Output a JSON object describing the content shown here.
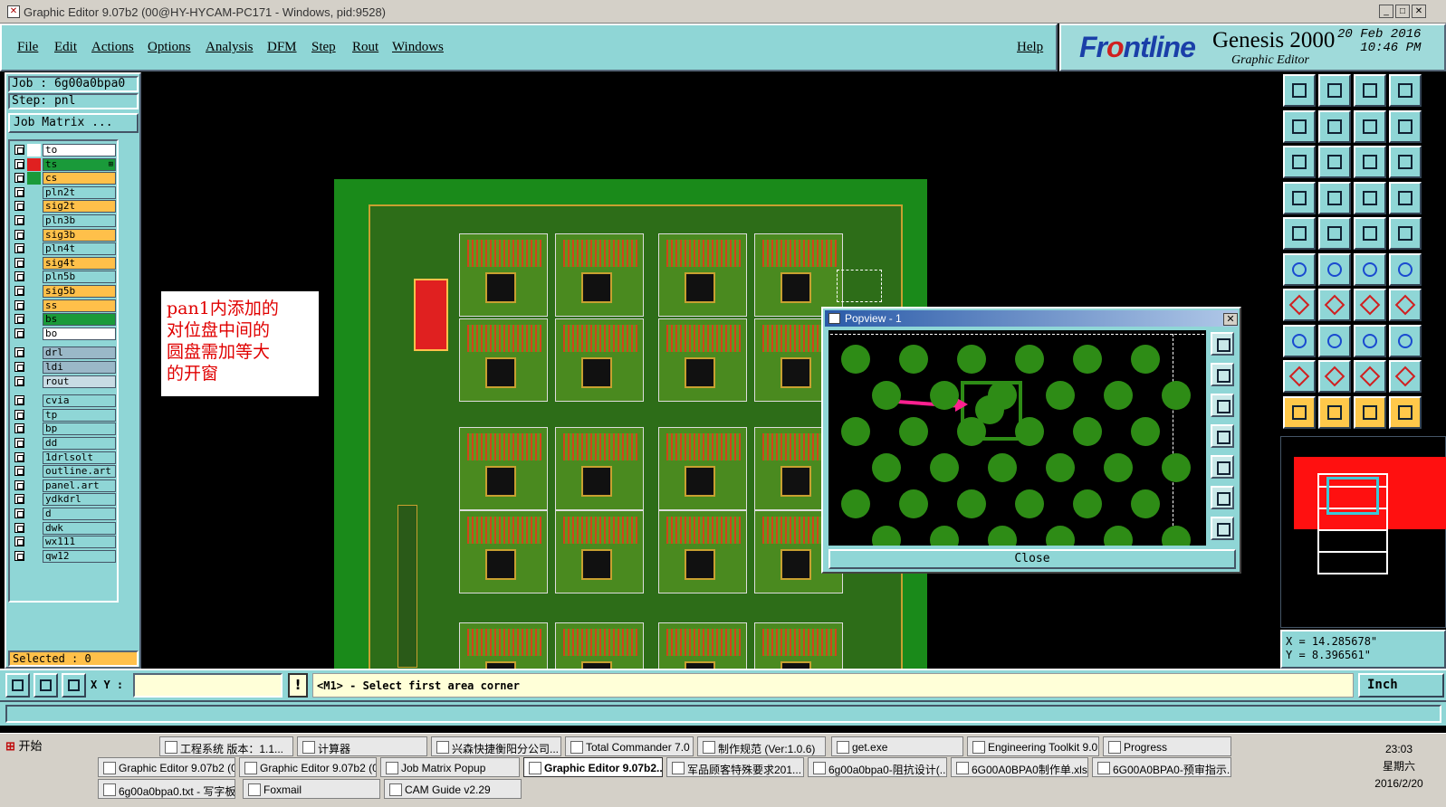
{
  "window": {
    "title": "Graphic Editor 9.07b2 (00@HY-HYCAM-PC171 - Windows, pid:9528)"
  },
  "menu": {
    "items": [
      "File",
      "Edit",
      "Actions",
      "Options",
      "Analysis",
      "DFM",
      "Step",
      "Rout",
      "Windows"
    ],
    "help": "Help"
  },
  "logo": {
    "brand_pre": "Fr",
    "brand_o": "o",
    "brand_post": "ntline",
    "product": "Genesis 2000",
    "subtitle": "Graphic Editor",
    "date": "20 Feb 2016",
    "time": "10:46 PM"
  },
  "job": {
    "job_label": "Job : 6g00a0bpa0",
    "step_label": "Step: pnl",
    "matrix_button": "Job Matrix ..."
  },
  "layers": [
    {
      "name": "to",
      "color": "#ffffff",
      "fill": "#ffffff"
    },
    {
      "name": "ts",
      "color": "#e02020",
      "fill": "#1a9a3a",
      "marker": "⊞"
    },
    {
      "name": "cs",
      "color": "#1a9a3a",
      "fill": "#ffc04a"
    },
    {
      "name": "pln2t",
      "color": "",
      "fill": "#8fd6d6"
    },
    {
      "name": "sig2t",
      "color": "",
      "fill": "#ffc04a"
    },
    {
      "name": "pln3b",
      "color": "",
      "fill": "#8fd6d6"
    },
    {
      "name": "sig3b",
      "color": "",
      "fill": "#ffc04a"
    },
    {
      "name": "pln4t",
      "color": "",
      "fill": "#8fd6d6"
    },
    {
      "name": "sig4t",
      "color": "",
      "fill": "#ffc04a"
    },
    {
      "name": "pln5b",
      "color": "",
      "fill": "#8fd6d6"
    },
    {
      "name": "sig5b",
      "color": "",
      "fill": "#ffc04a"
    },
    {
      "name": "ss",
      "color": "",
      "fill": "#ffc04a"
    },
    {
      "name": "bs",
      "color": "",
      "fill": "#1a9a3a"
    },
    {
      "name": "bo",
      "color": "",
      "fill": "#ffffff"
    },
    {
      "name": "drl",
      "color": "",
      "fill": "#9ab8c8"
    },
    {
      "name": "ldi",
      "color": "",
      "fill": "#9ab8c8"
    },
    {
      "name": "rout",
      "color": "",
      "fill": "#c8dce4"
    },
    {
      "name": "cvia",
      "color": "",
      "fill": "#8fd6d6"
    },
    {
      "name": "tp",
      "color": "",
      "fill": "#8fd6d6"
    },
    {
      "name": "bp",
      "color": "",
      "fill": "#8fd6d6"
    },
    {
      "name": "dd",
      "color": "",
      "fill": "#8fd6d6"
    },
    {
      "name": "1drlsolt",
      "color": "",
      "fill": "#8fd6d6"
    },
    {
      "name": "outline.art",
      "color": "",
      "fill": "#8fd6d6"
    },
    {
      "name": "panel.art",
      "color": "",
      "fill": "#8fd6d6"
    },
    {
      "name": "ydkdrl",
      "color": "",
      "fill": "#8fd6d6"
    },
    {
      "name": "d",
      "color": "",
      "fill": "#8fd6d6"
    },
    {
      "name": "dwk",
      "color": "",
      "fill": "#8fd6d6"
    },
    {
      "name": "wx111",
      "color": "",
      "fill": "#8fd6d6"
    },
    {
      "name": "qw12",
      "color": "",
      "fill": "#8fd6d6"
    }
  ],
  "selected": "Selected : 0",
  "annotation": {
    "lines": [
      "pan1内添加的",
      "对位盘中间的",
      "圆盘需加等大",
      "的开窗"
    ]
  },
  "popview": {
    "title": "Popview - 1",
    "close_label": "Close",
    "close_x": "✕"
  },
  "coords": {
    "x": "X  =  14.285678\"",
    "y": "Y  =  8.396561\""
  },
  "command": {
    "xy_label": "X Y :",
    "xy_value": "",
    "bang": "!",
    "prompt": "<M1> - Select first area corner",
    "units": "Inch"
  },
  "colors": {
    "panel_bg": "#8fd6d6",
    "board_green": "#2e8c16",
    "highlight": "#ffc04a",
    "arrow": "#ff2090"
  },
  "taskbar": {
    "start": "开始",
    "row1": [
      "工程系统  版本：1.1...",
      "计算器",
      "兴森快捷衡阳分公司...",
      "Total Commander 7.0 ...",
      "制作规范 (Ver:1.0.6)",
      "get.exe",
      "Engineering Toolkit 9.0...",
      "Progress"
    ],
    "row2": [
      "Graphic Editor 9.07b2 (0...",
      "Graphic Editor 9.07b2 (0...",
      "Job Matrix Popup",
      "Graphic Editor 9.07b2...",
      "军品顾客特殊要求201...",
      "6g00a0bpa0-阻抗设计(...",
      "6G00A0BPA0制作单.xls ...",
      "6G00A0BPA0-预审指示..."
    ],
    "row3": [
      "6g00a0bpa0.txt - 写字板",
      "Foxmail",
      "CAM  Guide v2.29"
    ],
    "clock": {
      "time": "23:03",
      "weekday": "星期六",
      "date": "2016/2/20"
    }
  }
}
